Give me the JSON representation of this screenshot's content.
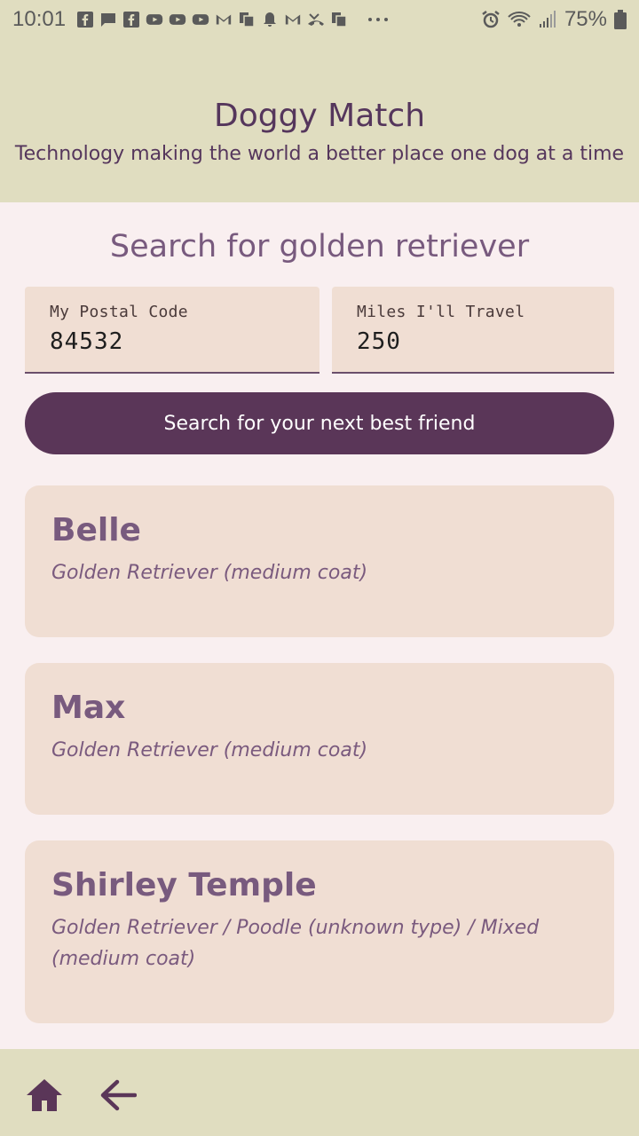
{
  "status_bar": {
    "time": "10:01",
    "battery": "75%",
    "icons": [
      "facebook-icon",
      "message-icon",
      "facebook-icon",
      "youtube-icon",
      "youtube-icon",
      "youtube-icon",
      "gmail-icon",
      "copy-icon",
      "bell-icon",
      "gmail-icon",
      "missed-call-icon",
      "copy-icon",
      "more-icon",
      "alarm-icon",
      "wifi-icon",
      "signal-icon",
      "battery-icon"
    ]
  },
  "header": {
    "title": "Doggy Match",
    "subtitle": "Technology making the world a better place one dog at a time"
  },
  "search": {
    "heading": "Search for golden retriever",
    "postal_label": "My Postal Code",
    "postal_value": "84532",
    "miles_label": "Miles I'll Travel",
    "miles_value": "250",
    "button_label": "Search for your next best friend"
  },
  "results": [
    {
      "name": "Belle",
      "breed": "Golden Retriever (medium coat)"
    },
    {
      "name": "Max",
      "breed": "Golden Retriever (medium coat)"
    },
    {
      "name": "Shirley Temple",
      "breed": "Golden Retriever / Poodle (unknown type) / Mixed (medium coat)"
    }
  ],
  "colors": {
    "header_bg": "#e0ddc0",
    "page_bg": "#f9eff0",
    "card_bg": "#f0ded3",
    "accent": "#5a3658"
  },
  "bottom_nav": {
    "icons": [
      "home-icon",
      "back-arrow-icon"
    ]
  }
}
